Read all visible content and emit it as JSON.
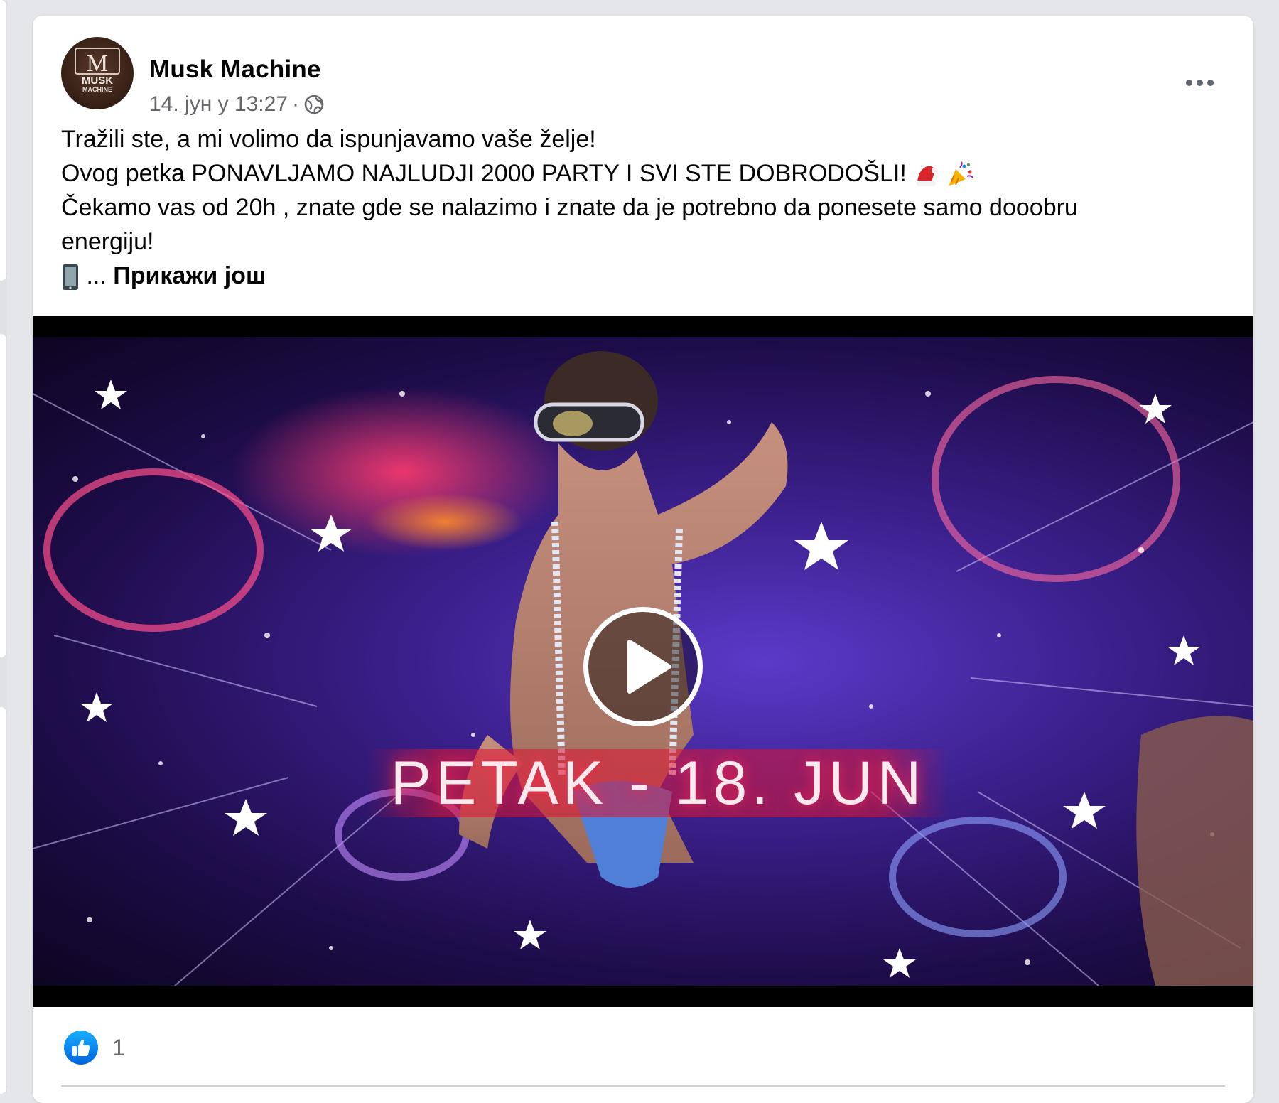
{
  "post": {
    "author": "Musk Machine",
    "avatar_text": {
      "logo_letters": "M",
      "brand": "MUSK",
      "sub": "MACHINE"
    },
    "date": "14. јун у 13:27",
    "separator": "·",
    "audience_icon": "globe-icon",
    "more_icon": "more-options-icon",
    "text_lines": [
      "Tražili ste, a mi volimo da ispunjavamo vaše želje!",
      "Ovog petka PONAVLJAMO NAJLUDJI 2000 PARTY I SVI STE DOBRODOŠLI!",
      "Čekamo vas od 20h , znate gde se nalazimo i znate da je potrebno da ponesete samo dooobru",
      "energiju!"
    ],
    "line2_emojis": [
      "santa-hat-icon",
      "party-popper-icon"
    ],
    "line5_icon": "mobile-phone-icon",
    "ellipsis": "...",
    "see_more": "Прикажи још"
  },
  "video": {
    "overlay_text": "PETAK - 18. JUN",
    "play_icon": "play-icon"
  },
  "reactions": {
    "icon": "like-icon",
    "count": "1"
  },
  "colors": {
    "page_bg": "#e4e6e9",
    "card_bg": "#ffffff",
    "text_primary": "#050505",
    "text_secondary": "#65676b",
    "like_blue": "#0866ff"
  }
}
